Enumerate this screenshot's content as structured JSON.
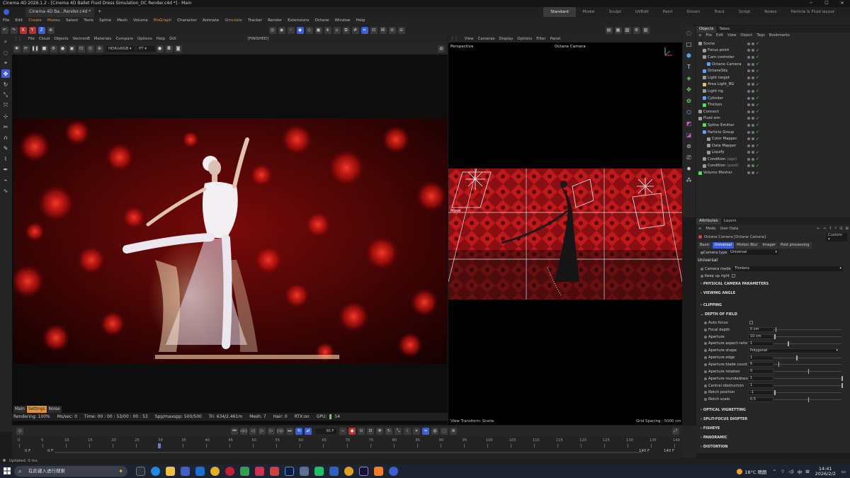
{
  "window": {
    "title": "Cinema 4D 2026.1.2 - [Cinema 4D Ballet Fluid Dress Simulation_OC Render.c4d *] - Main"
  },
  "tabs": {
    "documents": [
      "Cinema 4D Ba...Render.c4d *"
    ],
    "add_label": "+",
    "layouts": [
      "Standard",
      "Model",
      "Sculpt",
      "UVEdit",
      "Paint",
      "Groom",
      "Track",
      "Script",
      "Nodes",
      "Particle & Fluid layout"
    ],
    "active_layout": "Standard"
  },
  "main_menu": [
    "File",
    "Edit",
    "Create",
    "Modes",
    "Select",
    "Tools",
    "Spline",
    "Mesh",
    "Volume",
    "MoGraph",
    "Character",
    "Animate",
    "Simulate",
    "Tracker",
    "Render",
    "Extensions",
    "Octane",
    "Window",
    "Help"
  ],
  "axis_toolbar": [
    "X",
    "Y",
    "Z"
  ],
  "render_view": {
    "menu": [
      "File",
      "Cloud",
      "Objects",
      "VectronB",
      "Materials",
      "Compare",
      "Options",
      "Help",
      "GUI"
    ],
    "status_label": "[FINISHED]",
    "color_space": "HDR/sRGB",
    "tone": "PT",
    "bottom_tabs": [
      "Main",
      "Settings",
      "Noise"
    ],
    "status": {
      "rendering": "Rendering: 100%",
      "ms_sec": "Ms/sec: 0",
      "time": "Time: 00 : 00 : 53/00 : 00 : 53",
      "spp": "Spp/maxspp: 500/500",
      "tri": "Tri: 634/2.461m",
      "mesh": "Mesh: 7",
      "hair": "Hair: 0",
      "rtx": "RTX:on",
      "gpu": "GPU:",
      "gpu_val": "54"
    }
  },
  "viewport": {
    "menu": [
      "View",
      "Cameras",
      "Display",
      "Options",
      "Filter",
      "Panel"
    ],
    "label": "Perspective",
    "camera": "Octane Camera",
    "move_label": "Move",
    "view_transform": "View Transform: Scene",
    "grid_spacing": "Grid Spacing : 5000 cm"
  },
  "objects_panel": {
    "tabs": [
      "Objects",
      "Takes"
    ],
    "menu": [
      "File",
      "Edit",
      "View",
      "Object",
      "Tags",
      "Bookmarks"
    ],
    "items": [
      {
        "name": "Scene",
        "depth": 0,
        "color": "#9a9a9a"
      },
      {
        "name": "Focus point",
        "depth": 1,
        "color": "#9a9a9a"
      },
      {
        "name": "Cam controler",
        "depth": 1,
        "color": "#9a9a9a"
      },
      {
        "name": "Octane Camera",
        "depth": 2,
        "color": "#6aa0e0"
      },
      {
        "name": "OctaneSky",
        "depth": 1,
        "color": "#6aa0e0"
      },
      {
        "name": "Light target",
        "depth": 1,
        "color": "#9a9a9a"
      },
      {
        "name": "Area Light_BG",
        "depth": 1,
        "color": "#e0c060"
      },
      {
        "name": "Light rig",
        "depth": 1,
        "color": "#9a9a9a"
      },
      {
        "name": "Cylinder",
        "depth": 1,
        "color": "#6aa0e0"
      },
      {
        "name": "Thicken",
        "depth": 1,
        "color": "#6ad06a"
      },
      {
        "name": "Connect",
        "depth": 0,
        "color": "#9a9a9a"
      },
      {
        "name": "Fluid sim",
        "depth": 0,
        "color": "#9a9a9a"
      },
      {
        "name": "Spline Emitter",
        "depth": 1,
        "color": "#6ad06a"
      },
      {
        "name": "Particle Group",
        "depth": 1,
        "color": "#6aa0e0"
      },
      {
        "name": "Color Mapper",
        "depth": 2,
        "color": "#9a9a9a"
      },
      {
        "name": "Data Mapper",
        "depth": 2,
        "color": "#9a9a9a"
      },
      {
        "name": "Liquify",
        "depth": 2,
        "color": "#9a9a9a"
      },
      {
        "name": "Condition",
        "suffix": "(age)",
        "depth": 1,
        "color": "#9a9a9a"
      },
      {
        "name": "Condition",
        "suffix": "(positi",
        "depth": 1,
        "color": "#9a9a9a"
      },
      {
        "name": "Volume Mesher",
        "depth": 0,
        "color": "#6ad06a"
      }
    ]
  },
  "attributes_panel": {
    "tabs": [
      "Attributes",
      "Layers"
    ],
    "menu": [
      "Mode",
      "User Data"
    ],
    "object_title": "Octane Camera [Octane Camera]",
    "preset": "Custom",
    "subtabs": [
      "Basic",
      "Universal",
      "Motion Blur",
      "Imager",
      "Post processing"
    ],
    "active_subtab": "Universal",
    "camera_type_label": "Camera type",
    "camera_type": "Universal",
    "section_universal": "Universal",
    "camera_mode_label": "Camera mode",
    "camera_mode": "Thinlens",
    "keep_upright_label": "Keep up right",
    "sections": [
      "PHYSICAL CAMERA PARAMETERS",
      "VIEWING ANGLE",
      "CLIPPING",
      "DEPTH OF FIELD"
    ],
    "dof_params": [
      {
        "label": "Auto focus",
        "value": "",
        "slider": null,
        "checkbox": true
      },
      {
        "label": "Focal depth",
        "value": "0 cm",
        "slider": 0.02
      },
      {
        "label": "Aperture",
        "value": "10 cm",
        "slider": 0.0
      },
      {
        "label": "Aperture aspect ratio",
        "value": "1",
        "slider": 0.2
      },
      {
        "label": "Aperture shape",
        "value": "Polygonal",
        "slider": null,
        "dropdown": true
      },
      {
        "label": "Aperture edge",
        "value": "1",
        "slider": 0.33
      },
      {
        "label": "Aperture blade count",
        "value": "6",
        "slider": 0.06
      },
      {
        "label": "Aperture rotation",
        "value": "0",
        "slider": 0.5
      },
      {
        "label": "Aperture roundedness",
        "value": "1",
        "slider": 1.0
      },
      {
        "label": "Central obstruction",
        "value": "1",
        "slider": 1.0
      },
      {
        "label": "Notch position",
        "value": "-1",
        "slider": 0.0
      },
      {
        "label": "Notch scale",
        "value": "0.5",
        "slider": 0.5
      }
    ],
    "bottom_sections": [
      "OPTICAL VIGNETTING",
      "SPLIT-FOCUS DIOPTER",
      "FISHEYE",
      "PANORAMIC",
      "DISTORTION"
    ]
  },
  "timeline": {
    "ticks": [
      "0",
      "5",
      "10",
      "15",
      "20",
      "25",
      "30",
      "35",
      "40",
      "45",
      "50",
      "55",
      "60",
      "65",
      "70",
      "75",
      "80",
      "85",
      "90",
      "95",
      "100",
      "105",
      "110",
      "115",
      "120",
      "125",
      "130",
      "135",
      "140"
    ],
    "current_frame": "30 F",
    "playhead_fraction": 0.214,
    "start_frame": "0 F",
    "start_frame2": "0 F",
    "end_frame": "140 F",
    "end_frame2": "140 F"
  },
  "statusbar": {
    "text": "Updated: 0 ms."
  },
  "taskbar": {
    "search_placeholder": "在此键入进行搜索",
    "weather": "18°C 晴朗",
    "ime": "中",
    "time": "14:41",
    "date": "2026/2/2"
  }
}
